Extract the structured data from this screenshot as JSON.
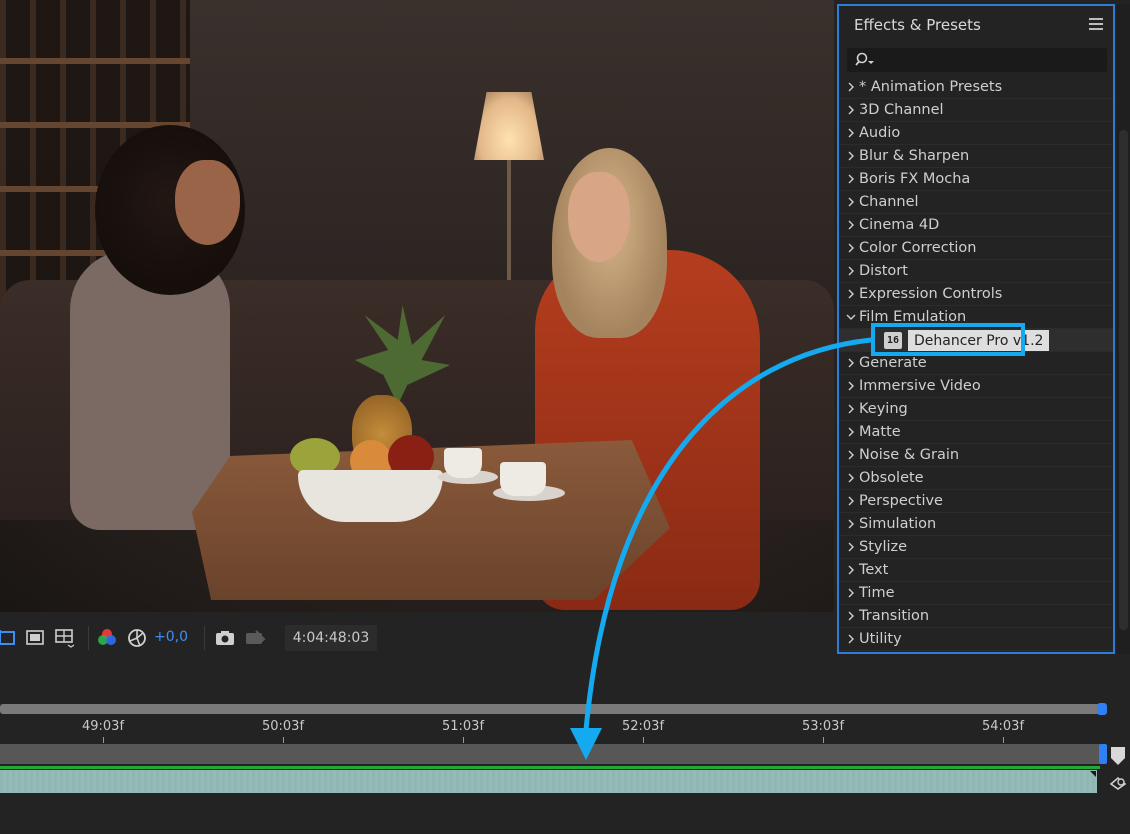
{
  "viewer": {
    "exposure_value": "+0,0",
    "timecode": "4:04:48:03",
    "toolbar_icons": [
      "region-of-interest-icon",
      "transparency-grid-icon",
      "guides-icon",
      "color-channels-icon",
      "reset-exposure-icon",
      "snapshot-icon",
      "show-snapshot-icon"
    ]
  },
  "effects_panel": {
    "title": "Effects & Presets",
    "search_placeholder": "",
    "categories": [
      {
        "label": "* Animation Presets",
        "expanded": false
      },
      {
        "label": "3D Channel",
        "expanded": false
      },
      {
        "label": "Audio",
        "expanded": false
      },
      {
        "label": "Blur & Sharpen",
        "expanded": false
      },
      {
        "label": "Boris FX Mocha",
        "expanded": false
      },
      {
        "label": "Channel",
        "expanded": false
      },
      {
        "label": "Cinema 4D",
        "expanded": false
      },
      {
        "label": "Color Correction",
        "expanded": false
      },
      {
        "label": "Distort",
        "expanded": false
      },
      {
        "label": "Expression Controls",
        "expanded": false
      },
      {
        "label": "Film Emulation",
        "expanded": true
      },
      {
        "label": "Generate",
        "expanded": false
      },
      {
        "label": "Immersive Video",
        "expanded": false
      },
      {
        "label": "Keying",
        "expanded": false
      },
      {
        "label": "Matte",
        "expanded": false
      },
      {
        "label": "Noise & Grain",
        "expanded": false
      },
      {
        "label": "Obsolete",
        "expanded": false
      },
      {
        "label": "Perspective",
        "expanded": false
      },
      {
        "label": "Simulation",
        "expanded": false
      },
      {
        "label": "Stylize",
        "expanded": false
      },
      {
        "label": "Text",
        "expanded": false
      },
      {
        "label": "Time",
        "expanded": false
      },
      {
        "label": "Transition",
        "expanded": false
      },
      {
        "label": "Utility",
        "expanded": false
      }
    ],
    "expanded_child": {
      "badge": "16",
      "label": "Dehancer Pro v1.2"
    },
    "highlight_color": "#15a9ef"
  },
  "timeline": {
    "ticks": [
      "49:03f",
      "50:03f",
      "51:03f",
      "52:03f",
      "53:03f",
      "54:03f"
    ],
    "accent_color": "#2f7ff5",
    "layer_color": "#8fb6b3"
  },
  "annotation": {
    "arrow_color": "#15a9ef"
  }
}
